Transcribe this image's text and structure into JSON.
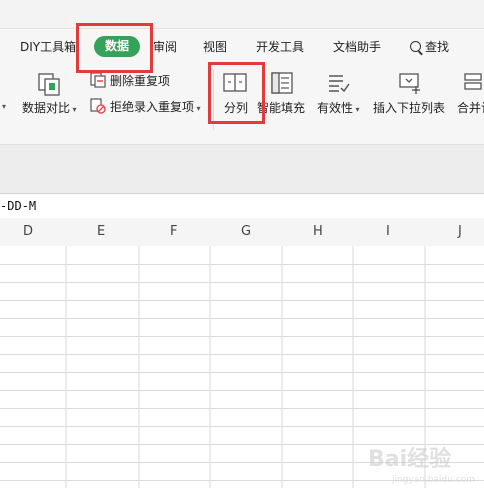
{
  "menubar": {
    "tabs": [
      {
        "label": "DIY工具箱"
      },
      {
        "label": "数据",
        "active": true
      },
      {
        "label": "审阅"
      },
      {
        "label": "视图"
      },
      {
        "label": "开发工具"
      },
      {
        "label": "文档助手"
      }
    ],
    "search_label": "查找",
    "active_color": "#35a25a"
  },
  "ribbon": {
    "compare_label": "数据对比",
    "remove_dup_label": "删除重复项",
    "reject_dup_label": "拒绝录入重复项",
    "split_label": "分列",
    "smart_fill_label": "智能填充",
    "validity_label": "有效性",
    "dropdown_label": "插入下拉列表",
    "merge_label": "合并计"
  },
  "formula": {
    "value": "-DD-M"
  },
  "columns": [
    "D",
    "E",
    "F",
    "G",
    "H",
    "I",
    "J"
  ],
  "highlight_color": "#e23b3b",
  "watermark": {
    "text": "Bai经验",
    "url": "jingyan.baidu.com"
  }
}
